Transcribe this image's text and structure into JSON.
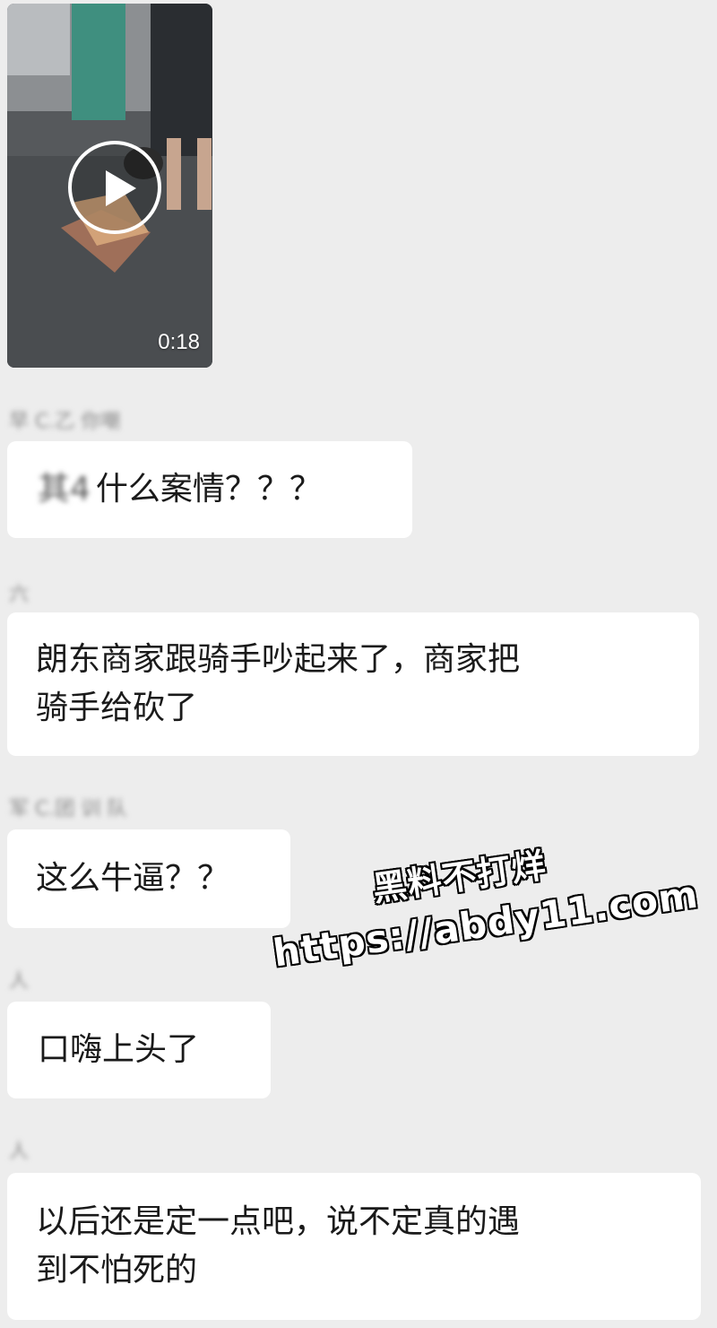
{
  "video": {
    "duration": "0:18"
  },
  "messages": [
    {
      "sender": "早 C.乙 你嘲",
      "mention": "其4",
      "text_lines": [
        "什么案情？？？"
      ]
    },
    {
      "sender": "六",
      "text_lines": [
        "朗东商家跟骑手吵起来了，商家把",
        "骑手给砍了"
      ]
    },
    {
      "sender": "军 C.团 训 队",
      "text_lines": [
        "这么牛逼？？"
      ]
    },
    {
      "sender": "人",
      "text_lines": [
        "口嗨上头了"
      ]
    },
    {
      "sender": "人",
      "text_lines": [
        "以后还是定一点吧，说不定真的遇",
        "到不怕死的"
      ]
    }
  ],
  "watermark": {
    "line1": "黑料不打烊",
    "line2": "https://abdy11.com"
  }
}
